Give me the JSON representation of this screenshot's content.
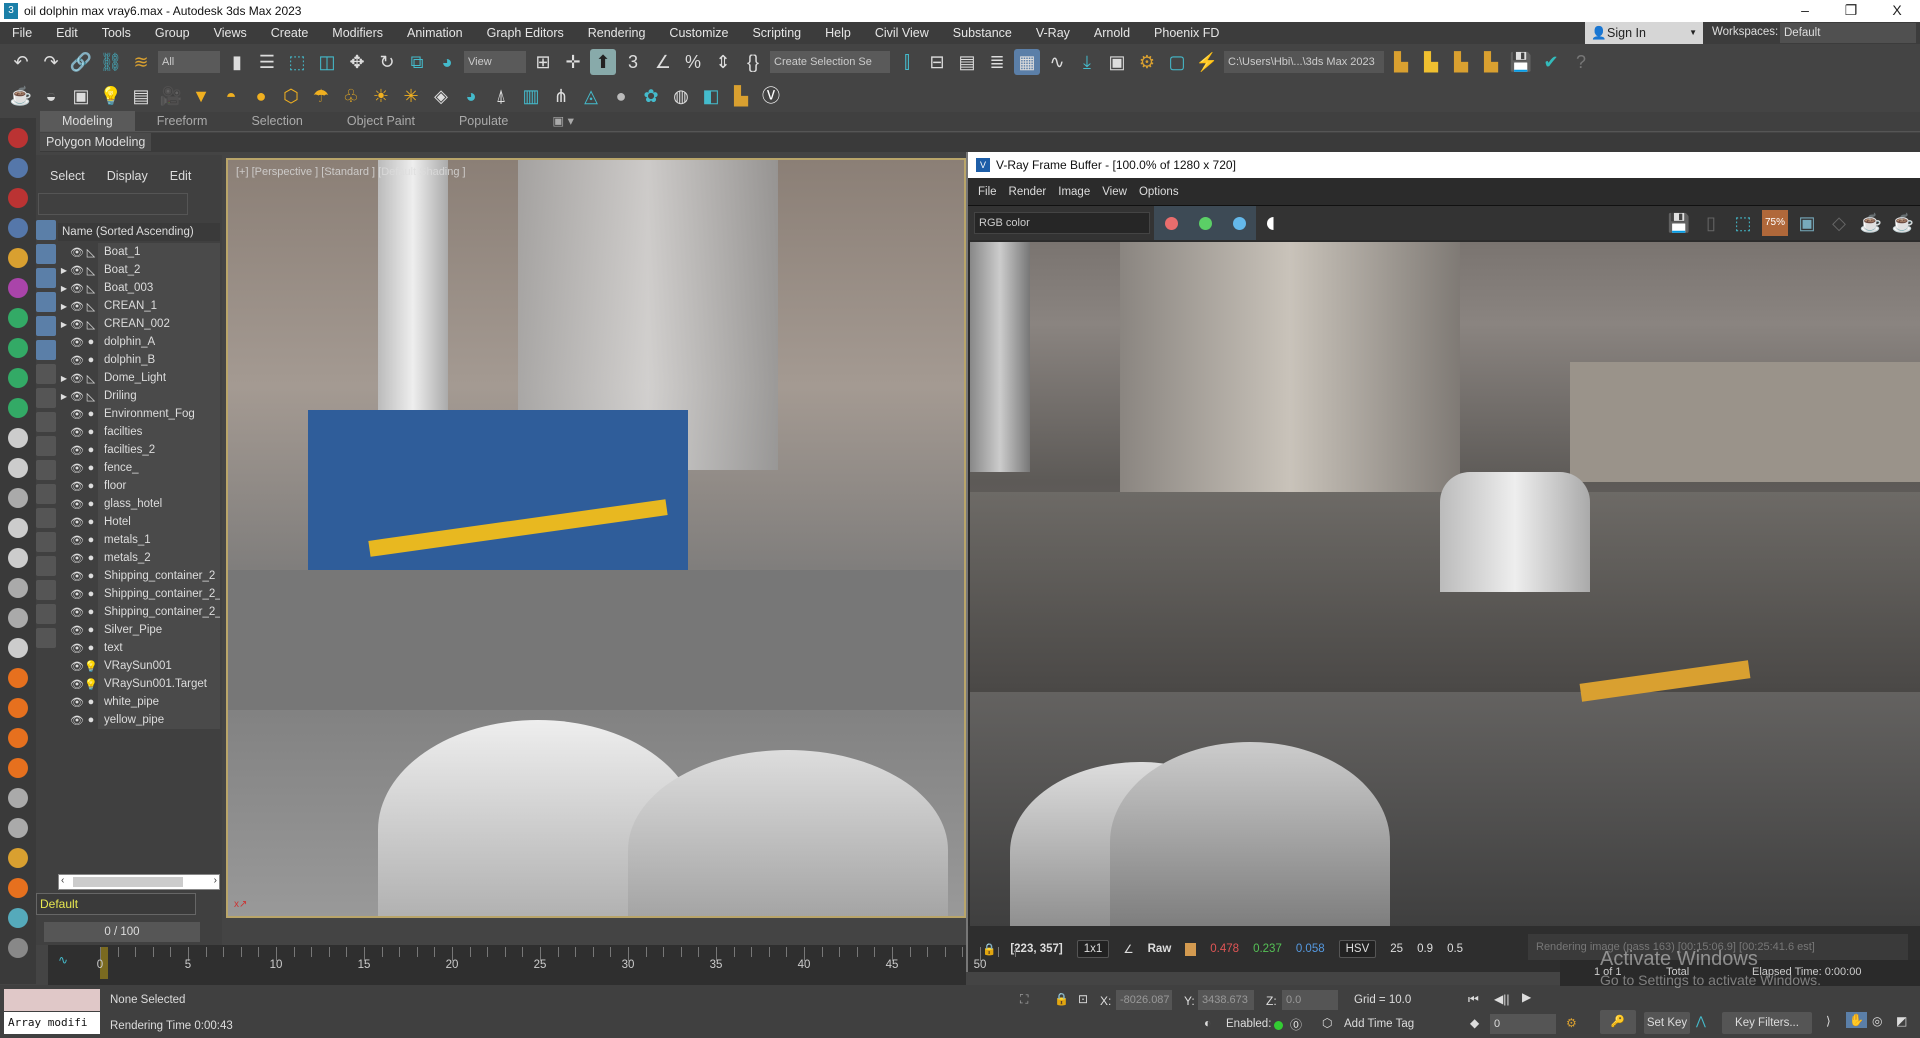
{
  "window": {
    "title": "oil dolphin max vray6.max - Autodesk 3ds Max 2023",
    "minimize": "–",
    "restore": "❐",
    "close": "X"
  },
  "menu": [
    "File",
    "Edit",
    "Tools",
    "Group",
    "Views",
    "Create",
    "Modifiers",
    "Animation",
    "Graph Editors",
    "Rendering",
    "Customize",
    "Scripting",
    "Help",
    "Civil View",
    "Substance",
    "V-Ray",
    "Arnold",
    "Phoenix FD"
  ],
  "account": {
    "sign_in": "Sign In",
    "workspaces_label": "Workspaces:",
    "workspace": "Default"
  },
  "toolbar": {
    "selection_filter": "All",
    "ref_coord": "View",
    "named_selection": "Create Selection Se",
    "project_path": "C:\\Users\\Hbi\\...\\3ds Max 2023"
  },
  "ribbon": {
    "tabs": [
      "Modeling",
      "Freeform",
      "Selection",
      "Object Paint",
      "Populate"
    ],
    "panel": "Polygon Modeling"
  },
  "scene_explorer": {
    "menu": [
      "Select",
      "Display",
      "Edit"
    ],
    "column_header": "Name (Sorted Ascending)",
    "items": [
      {
        "name": "Boat_1",
        "expandable": false,
        "type": "geometry"
      },
      {
        "name": "Boat_2",
        "expandable": true,
        "type": "geometry"
      },
      {
        "name": "Boat_003",
        "expandable": true,
        "type": "geometry"
      },
      {
        "name": "CREAN_1",
        "expandable": true,
        "type": "geometry"
      },
      {
        "name": "CREAN_002",
        "expandable": true,
        "type": "geometry"
      },
      {
        "name": "dolphin_A",
        "expandable": false,
        "type": "object"
      },
      {
        "name": "dolphin_B",
        "expandable": false,
        "type": "object"
      },
      {
        "name": "Dome_Light",
        "expandable": true,
        "type": "geometry"
      },
      {
        "name": "Driling",
        "expandable": true,
        "type": "geometry"
      },
      {
        "name": "Environment_Fog",
        "expandable": false,
        "type": "object"
      },
      {
        "name": "facilties",
        "expandable": false,
        "type": "object"
      },
      {
        "name": "facilties_2",
        "expandable": false,
        "type": "object"
      },
      {
        "name": "fence_",
        "expandable": false,
        "type": "object"
      },
      {
        "name": "floor",
        "expandable": false,
        "type": "object"
      },
      {
        "name": "glass_hotel",
        "expandable": false,
        "type": "object"
      },
      {
        "name": "Hotel",
        "expandable": false,
        "type": "object"
      },
      {
        "name": "metals_1",
        "expandable": false,
        "type": "object"
      },
      {
        "name": "metals_2",
        "expandable": false,
        "type": "object"
      },
      {
        "name": "Shipping_container_2",
        "expandable": false,
        "type": "object"
      },
      {
        "name": "Shipping_container_2_",
        "expandable": false,
        "type": "object"
      },
      {
        "name": "Shipping_container_2_",
        "expandable": false,
        "type": "object"
      },
      {
        "name": "Silver_Pipe",
        "expandable": false,
        "type": "object"
      },
      {
        "name": "text",
        "expandable": false,
        "type": "object"
      },
      {
        "name": "VRaySun001",
        "expandable": false,
        "type": "light"
      },
      {
        "name": "VRaySun001.Target",
        "expandable": false,
        "type": "light"
      },
      {
        "name": "white_pipe",
        "expandable": false,
        "type": "object"
      },
      {
        "name": "yellow_pipe",
        "expandable": false,
        "type": "object"
      }
    ],
    "layer": "Default"
  },
  "viewport": {
    "label": "[+] [Perspective ] [Standard ] [Default Shading ]"
  },
  "vfb": {
    "title": "V-Ray Frame Buffer - [100.0% of 1280 x 720]",
    "menu": [
      "File",
      "Render",
      "Image",
      "View",
      "Options"
    ],
    "channel": "RGB color",
    "zoom_badge": "75%",
    "status": {
      "pixel": "[223, 357]",
      "sampling": "1x1",
      "mode": "Raw",
      "r": "0.478",
      "g": "0.237",
      "b": "0.058",
      "color_space": "HSV",
      "h": "25",
      "s": "0.9",
      "v": "0.5",
      "progress": "Rendering image (pass 163) [00:15:06.9] [00:25:41.6 est]"
    }
  },
  "timeline": {
    "frame_slider": "0 / 100",
    "labels": [
      "0",
      "5",
      "10",
      "15",
      "20",
      "25",
      "30",
      "35",
      "40",
      "45",
      "50"
    ]
  },
  "statusbar": {
    "maxscript_input": "Array modifi",
    "selection": "None Selected",
    "render_time": "Rendering Time  0:00:43",
    "x_label": "X:",
    "x": "-8026.087",
    "y_label": "Y:",
    "y": "3438.673",
    "z_label": "Z:",
    "z": "0.0",
    "grid": "Grid = 10.0",
    "enabled_label": "Enabled:",
    "add_time_tag": "Add Time Tag",
    "frame": "0",
    "set_key": "Set Key",
    "key_filters": "Key Filters...",
    "render_panel": {
      "count": "1 of 1",
      "total": "Total",
      "elapsed": "Elapsed Time:  0:00:00"
    }
  },
  "watermark": {
    "line1": "Activate Windows",
    "line2": "Go to Settings to activate Windows."
  },
  "colors": {
    "accent_blue": "#5b7fa8",
    "viewport_border": "#b9a56a",
    "vfb_red": "#e96d6d",
    "vfb_green": "#5bcf66",
    "vfb_blue": "#64b8ea",
    "zoom_orange": "#b0683a"
  }
}
